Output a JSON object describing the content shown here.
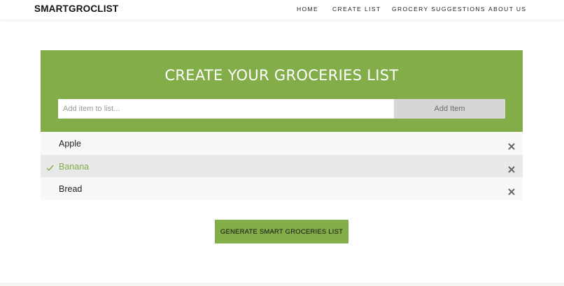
{
  "navbar": {
    "brand": "SMARTGROCLIST",
    "links": [
      "HOME",
      "CREATE LIST",
      "GROCERY SUGGESTIONS",
      "ABOUT US"
    ]
  },
  "panel": {
    "title": "CREATE YOUR GROCERIES LIST",
    "input": {
      "value": "",
      "placeholder": "Add item to list..."
    },
    "add_button": "Add Item"
  },
  "list": {
    "items": [
      {
        "label": "Apple",
        "checked": false
      },
      {
        "label": "Banana",
        "checked": true
      },
      {
        "label": "Bread",
        "checked": false
      }
    ],
    "remove_icon": "close-icon",
    "check_icon": "check-icon"
  },
  "generate_button": "GENERATE SMART GROCERIES LIST",
  "colors": {
    "accent": "#82ad49",
    "button_gray": "#d6d6d6",
    "row_light": "#f8f8f8",
    "row_checked": "#e9e9e9"
  }
}
